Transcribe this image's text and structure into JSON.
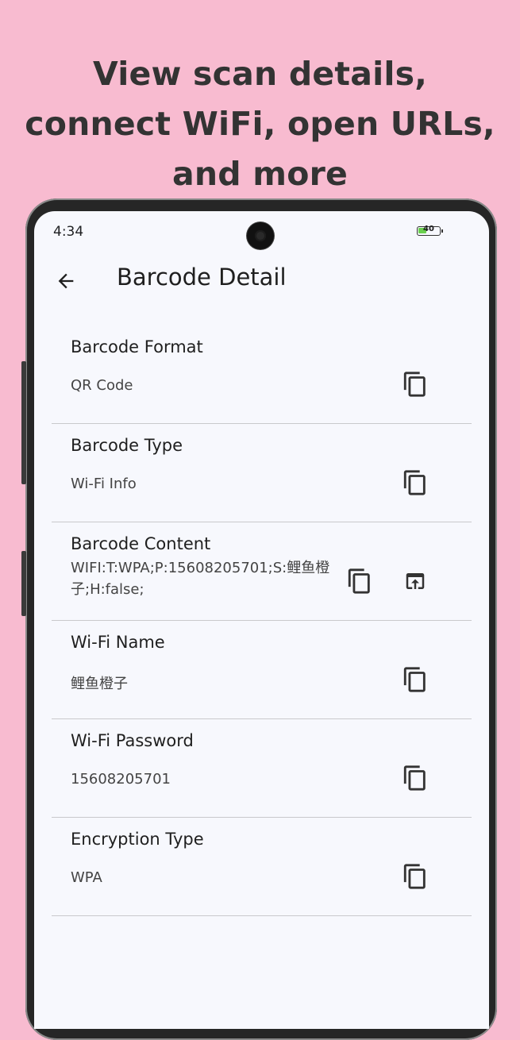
{
  "promo": {
    "line1": "View scan details,",
    "line2": "connect WiFi, open URLs,",
    "line3": "and more"
  },
  "status_bar": {
    "time": "4:34",
    "battery": "40",
    "battery_level": 0.4,
    "battery_color": "#6ad04e"
  },
  "appbar": {
    "title": "Barcode Detail",
    "back_icon": "arrow-back-icon"
  },
  "details": [
    {
      "label": "Barcode Format",
      "value": "QR Code"
    },
    {
      "label": "Barcode Type",
      "value": "Wi-Fi Info"
    },
    {
      "label": "Barcode Content",
      "value": "WIFI:T:WPA;P:15608205701;S:鲤鱼橙子;H:false;"
    },
    {
      "label": "Wi-Fi Name",
      "value": "鲤鱼橙子"
    },
    {
      "label": "Wi-Fi Password",
      "value": "15608205701"
    },
    {
      "label": "Encryption Type",
      "value": "WPA"
    }
  ],
  "icons": {
    "copy": "copy-icon",
    "open": "open-in-app-icon"
  },
  "colors": {
    "background": "#f8bbd0",
    "screen": "#f7f8fd",
    "divider": "#c9c9cc"
  }
}
